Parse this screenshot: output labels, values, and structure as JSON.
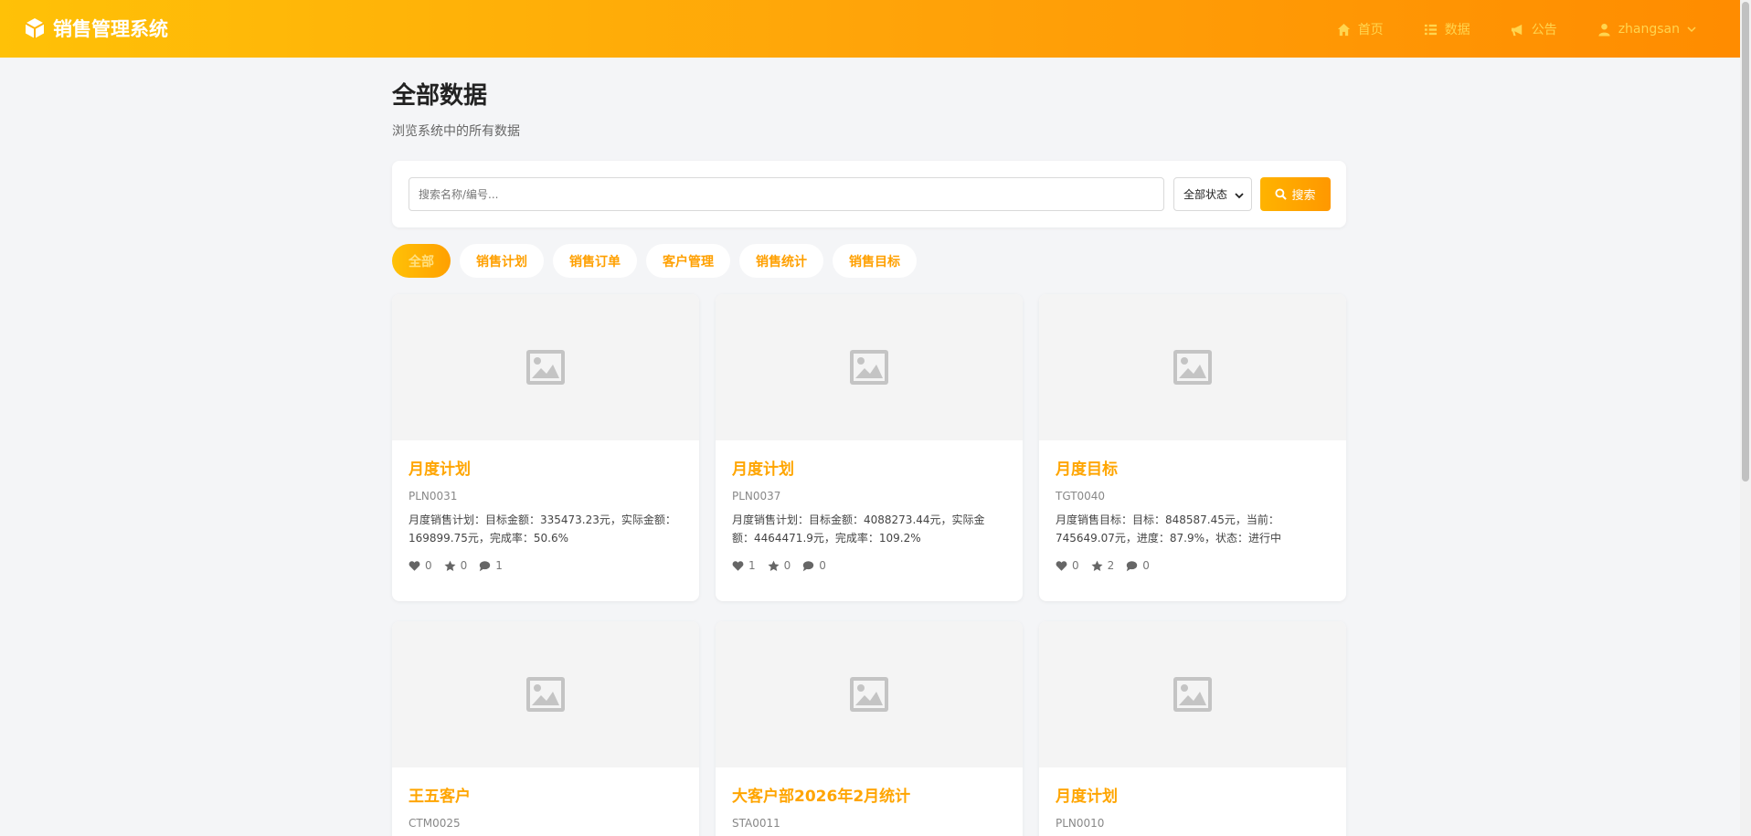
{
  "header": {
    "brand": "销售管理系统",
    "nav": {
      "home": "首页",
      "data": "数据",
      "notice": "公告",
      "user": "zhangsan"
    }
  },
  "page": {
    "title": "全部数据",
    "subtitle": "浏览系统中的所有数据"
  },
  "search": {
    "placeholder": "搜索名称/编号...",
    "status_selected": "全部状态",
    "button": "搜索"
  },
  "tabs": [
    "全部",
    "销售计划",
    "销售订单",
    "客户管理",
    "销售统计",
    "销售目标"
  ],
  "cards": [
    {
      "title": "月度计划",
      "code": "PLN0031",
      "desc": "月度销售计划：目标金额：335473.23元，实际金额：169899.75元，完成率：50.6%",
      "likes": "0",
      "stars": "0",
      "comments": "1"
    },
    {
      "title": "月度计划",
      "code": "PLN0037",
      "desc": "月度销售计划：目标金额：4088273.44元，实际金额：4464471.9元，完成率：109.2%",
      "likes": "1",
      "stars": "0",
      "comments": "0"
    },
    {
      "title": "月度目标",
      "code": "TGT0040",
      "desc": "月度销售目标：目标：848587.45元，当前：745649.07元，进度：87.9%，状态：进行中",
      "likes": "0",
      "stars": "2",
      "comments": "0"
    },
    {
      "title": "王五客户",
      "code": "CTM0025",
      "desc": "",
      "likes": "",
      "stars": "",
      "comments": ""
    },
    {
      "title": "大客户部2026年2月统计",
      "code": "STA0011",
      "desc": "",
      "likes": "",
      "stars": "",
      "comments": ""
    },
    {
      "title": "月度计划",
      "code": "PLN0010",
      "desc": "",
      "likes": "",
      "stars": "",
      "comments": ""
    }
  ]
}
